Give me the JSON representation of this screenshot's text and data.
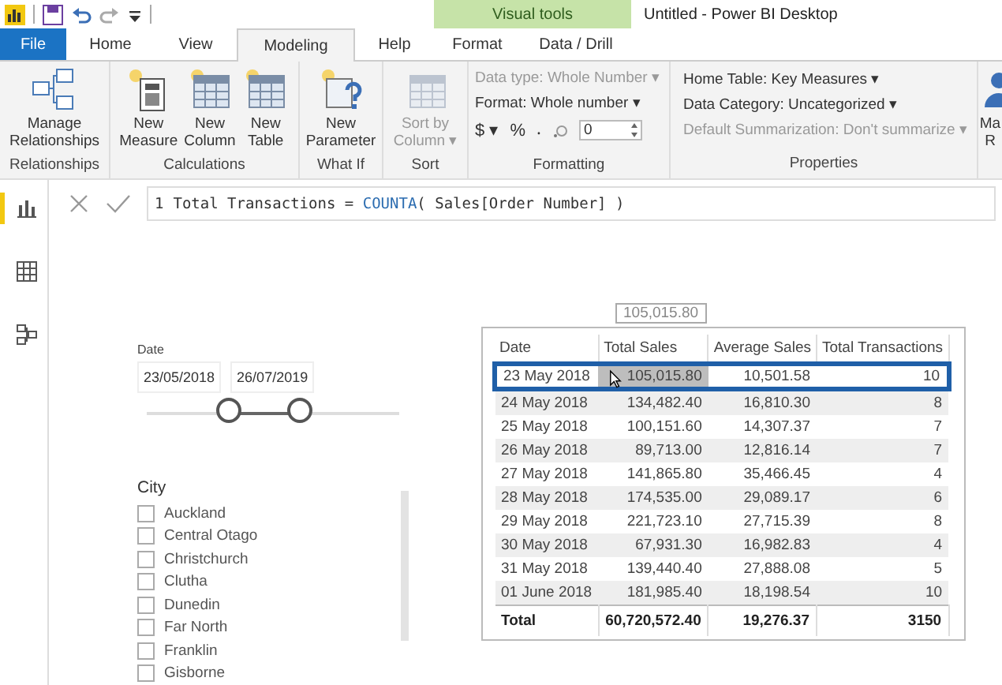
{
  "title_bar": {
    "contextual_group": "Visual tools",
    "title": "Untitled - Power BI Desktop"
  },
  "tabs": [
    {
      "label": "File",
      "kind": "file",
      "selected": false
    },
    {
      "label": "Home",
      "kind": "normal",
      "selected": false
    },
    {
      "label": "View",
      "kind": "normal",
      "selected": false
    },
    {
      "label": "Modeling",
      "kind": "normal",
      "selected": true
    },
    {
      "label": "Help",
      "kind": "normal",
      "selected": false
    },
    {
      "label": "Format",
      "kind": "context",
      "selected": false
    },
    {
      "label": "Data / Drill",
      "kind": "context",
      "selected": false
    }
  ],
  "ribbon": {
    "groups": [
      {
        "label": "Relationships",
        "kind": "buttons",
        "buttons": [
          {
            "lines": [
              "Manage",
              "Relationships"
            ],
            "disabled": false
          }
        ]
      },
      {
        "label": "Calculations",
        "kind": "buttons",
        "buttons": [
          {
            "lines": [
              "New",
              "Measure"
            ],
            "disabled": false
          },
          {
            "lines": [
              "New",
              "Column"
            ],
            "disabled": false
          },
          {
            "lines": [
              "New",
              "Table"
            ],
            "disabled": false
          }
        ]
      },
      {
        "label": "What If",
        "kind": "buttons",
        "buttons": [
          {
            "lines": [
              "New",
              "Parameter"
            ],
            "disabled": false
          }
        ]
      },
      {
        "label": "Sort",
        "kind": "buttons",
        "buttons": [
          {
            "lines": [
              "Sort by",
              "Column ▾"
            ],
            "disabled": true
          }
        ]
      },
      {
        "label": "Formatting",
        "kind": "formatting",
        "rows": [
          {
            "text": "Data type: Whole Number ▾",
            "disabled": true
          },
          {
            "text": "Format: Whole number ▾",
            "disabled": false
          }
        ],
        "symbols": [
          "$ ▾",
          "%",
          "‧"
        ],
        "decimals": "0"
      },
      {
        "label": "Properties",
        "kind": "lines",
        "rows": [
          {
            "text": "Home Table: Key Measures ▾",
            "disabled": false
          },
          {
            "text": "Data Category: Uncategorized ▾",
            "disabled": false
          },
          {
            "text": "Default Summarization: Don't summarize ▾",
            "disabled": true
          }
        ]
      },
      {
        "kind": "cut",
        "buttons": [
          {
            "lines": [
              "Ma",
              "R"
            ],
            "disabled": false
          }
        ]
      }
    ]
  },
  "sidebar": [
    {
      "selected": true
    },
    {
      "selected": false
    },
    {
      "selected": false
    }
  ],
  "formula": {
    "line_number": "1",
    "tokens": [
      {
        "text": "Total Transactions = ",
        "kind": "text"
      },
      {
        "text": "COUNTA",
        "kind": "function"
      },
      {
        "text": "( Sales[Order Number] )",
        "kind": "text"
      }
    ]
  },
  "date_slicer": {
    "title": "Date",
    "start": "23/05/2018",
    "end": "26/07/2019",
    "thumbs": [
      {
        "level": 0.34
      },
      {
        "level": 0.62
      }
    ]
  },
  "city_slicer": {
    "title": "City",
    "items": [
      {
        "label": "Auckland",
        "checked": false
      },
      {
        "label": "Central Otago",
        "checked": false
      },
      {
        "label": "Christchurch",
        "checked": false
      },
      {
        "label": "Clutha",
        "checked": false
      },
      {
        "label": "Dunedin",
        "checked": false
      },
      {
        "label": "Far North",
        "checked": false
      },
      {
        "label": "Franklin",
        "checked": false
      },
      {
        "label": "Gisborne",
        "checked": false
      }
    ]
  },
  "table": {
    "columns": [
      "Date",
      "Total Sales",
      "Average Sales",
      "Total Transactions"
    ],
    "rows": [
      {
        "cells": [
          "23 May 2018",
          "105,015.80",
          "10,501.58",
          "10"
        ],
        "selected": true
      },
      {
        "cells": [
          "24 May 2018",
          "134,482.40",
          "16,810.30",
          "8"
        ],
        "selected": false
      },
      {
        "cells": [
          "25 May 2018",
          "100,151.60",
          "14,307.37",
          "7"
        ],
        "selected": false
      },
      {
        "cells": [
          "26 May 2018",
          "89,713.00",
          "12,816.14",
          "7"
        ],
        "selected": false
      },
      {
        "cells": [
          "27 May 2018",
          "141,865.80",
          "35,466.45",
          "4"
        ],
        "selected": false
      },
      {
        "cells": [
          "28 May 2018",
          "174,535.00",
          "29,089.17",
          "6"
        ],
        "selected": false
      },
      {
        "cells": [
          "29 May 2018",
          "221,723.10",
          "27,715.39",
          "8"
        ],
        "selected": false
      },
      {
        "cells": [
          "30 May 2018",
          "67,931.30",
          "16,982.83",
          "4"
        ],
        "selected": false
      },
      {
        "cells": [
          "31 May 2018",
          "139,440.40",
          "27,888.08",
          "5"
        ],
        "selected": false
      },
      {
        "cells": [
          "01 June 2018",
          "181,985.40",
          "18,198.54",
          "10"
        ],
        "selected": false
      }
    ],
    "total": [
      "Total",
      "60,720,572.40",
      "19,276.37",
      "3150"
    ],
    "tooltip": "105,015.80"
  }
}
